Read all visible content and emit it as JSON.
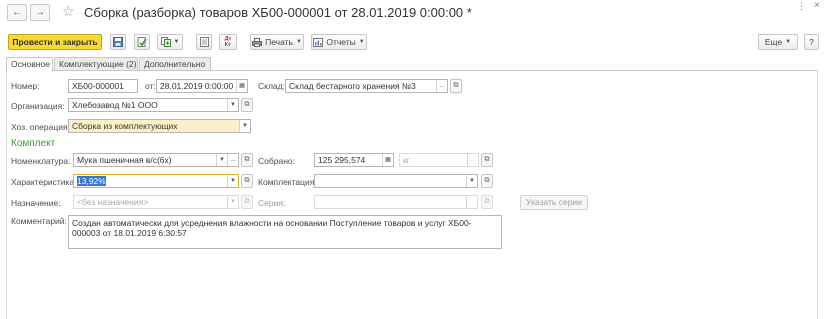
{
  "window": {
    "title": "Сборка (разборка) товаров ХБ00-000001 от 28.01.2019 0:00:00 *",
    "nav": {
      "back_icon": "arrow-left-icon",
      "forward_icon": "arrow-right-icon"
    },
    "controls": {
      "more": "⋮",
      "close": "×"
    }
  },
  "toolbar": {
    "post_and_close": "Провести и закрыть",
    "print": "Печать",
    "reports": "Отчеты",
    "more": "Еще",
    "help": "?"
  },
  "tabs": [
    {
      "label": "Основное",
      "active": true
    },
    {
      "label": "Комплектующие (2)",
      "active": false
    },
    {
      "label": "Дополнительно",
      "active": false
    }
  ],
  "form": {
    "number": {
      "label": "Номер:",
      "value": "ХБ00-000001"
    },
    "date": {
      "label": "от:",
      "value": "28.01.2019  0:00:00"
    },
    "warehouse": {
      "label": "Склад:",
      "value": "Склад бестарного хранения №3"
    },
    "organization": {
      "label": "Организация:",
      "value": "Хлебозавод №1 ООО"
    },
    "operation": {
      "label": "Хоз. операция:",
      "value": "Сборка из комплектующих"
    },
    "kit_section": "Комплект",
    "nomenclature": {
      "label": "Номенклатура:",
      "value": "Мука пшеничная в/с(6х)"
    },
    "collected": {
      "label": "Собрано:",
      "value": "125 295,574",
      "unit_placeholder": "кг"
    },
    "characteristic": {
      "label": "Характеристика:",
      "value": "13,92%"
    },
    "kitting": {
      "label": "Комплектация:",
      "value": ""
    },
    "purpose": {
      "label": "Назначение:",
      "placeholder": "<без назначения>"
    },
    "series": {
      "label": "Серия:",
      "value": ""
    },
    "specify_series": "Указать серии",
    "comment": {
      "label": "Комментарий:",
      "value": "Создан автоматически для усреднения влажности на основании Поступление товаров и услуг ХБ00-000003 от 18.01.2019 6:30:57"
    }
  }
}
